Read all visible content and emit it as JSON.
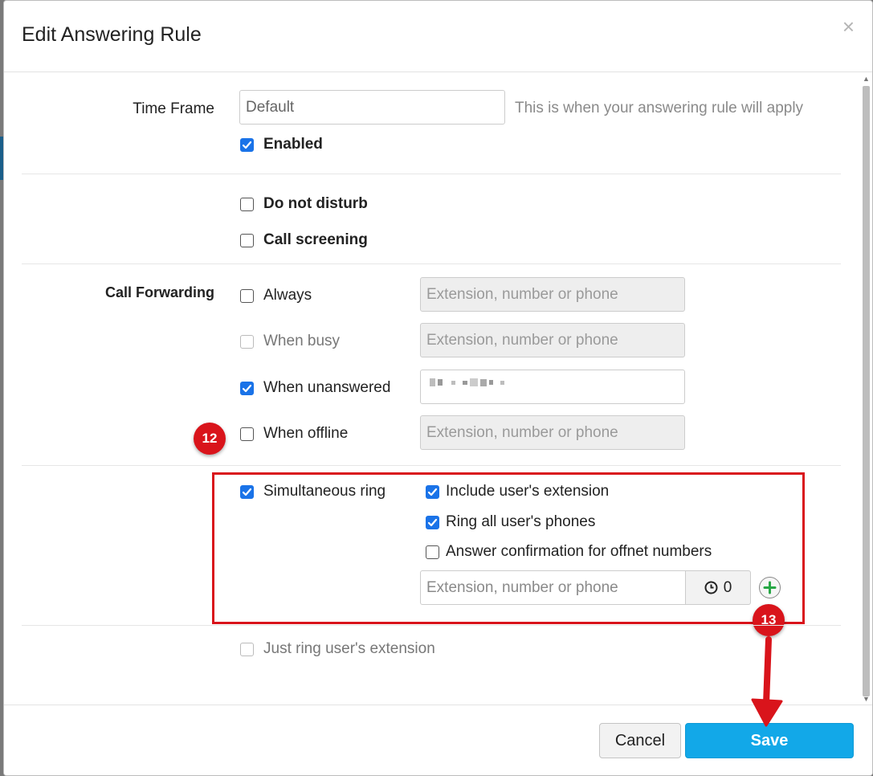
{
  "dialog": {
    "title": "Edit Answering Rule",
    "close_symbol": "×"
  },
  "time_frame": {
    "label": "Time Frame",
    "value": "Default",
    "help": "This is when your answering rule will apply",
    "enabled_label": "Enabled",
    "enabled": true
  },
  "options": {
    "do_not_disturb": {
      "label": "Do not disturb",
      "checked": false
    },
    "call_screening": {
      "label": "Call screening",
      "checked": false
    }
  },
  "call_forwarding": {
    "label": "Call Forwarding",
    "placeholder": "Extension, number or phone",
    "rows": [
      {
        "label": "Always",
        "checked": false,
        "disabled": false
      },
      {
        "label": "When busy",
        "checked": false,
        "disabled": true
      },
      {
        "label": "When unanswered",
        "checked": true,
        "disabled": false
      },
      {
        "label": "When offline",
        "checked": false,
        "disabled": false
      }
    ]
  },
  "simultaneous_ring": {
    "label": "Simultaneous ring",
    "checked": true,
    "include_extension": {
      "label": "Include user's extension",
      "checked": true
    },
    "ring_all_phones": {
      "label": "Ring all user's phones",
      "checked": true
    },
    "answer_confirmation": {
      "label": "Answer confirmation for offnet numbers",
      "checked": false
    },
    "placeholder": "Extension, number or phone",
    "timer_value": "0"
  },
  "just_ring": {
    "label": "Just ring user's extension",
    "checked": false
  },
  "annotations": {
    "badge_12": "12",
    "badge_13": "13",
    "color": "#d9141b"
  },
  "footer": {
    "cancel_label": "Cancel",
    "save_label": "Save"
  },
  "icons": {
    "close": "close-icon",
    "clock": "clock-icon",
    "add": "plus-circle-icon",
    "check": "checkmark-icon"
  },
  "colors": {
    "accent": "#1a73e8",
    "save_button": "#12a8e8",
    "annotation_red": "#d9141b"
  }
}
